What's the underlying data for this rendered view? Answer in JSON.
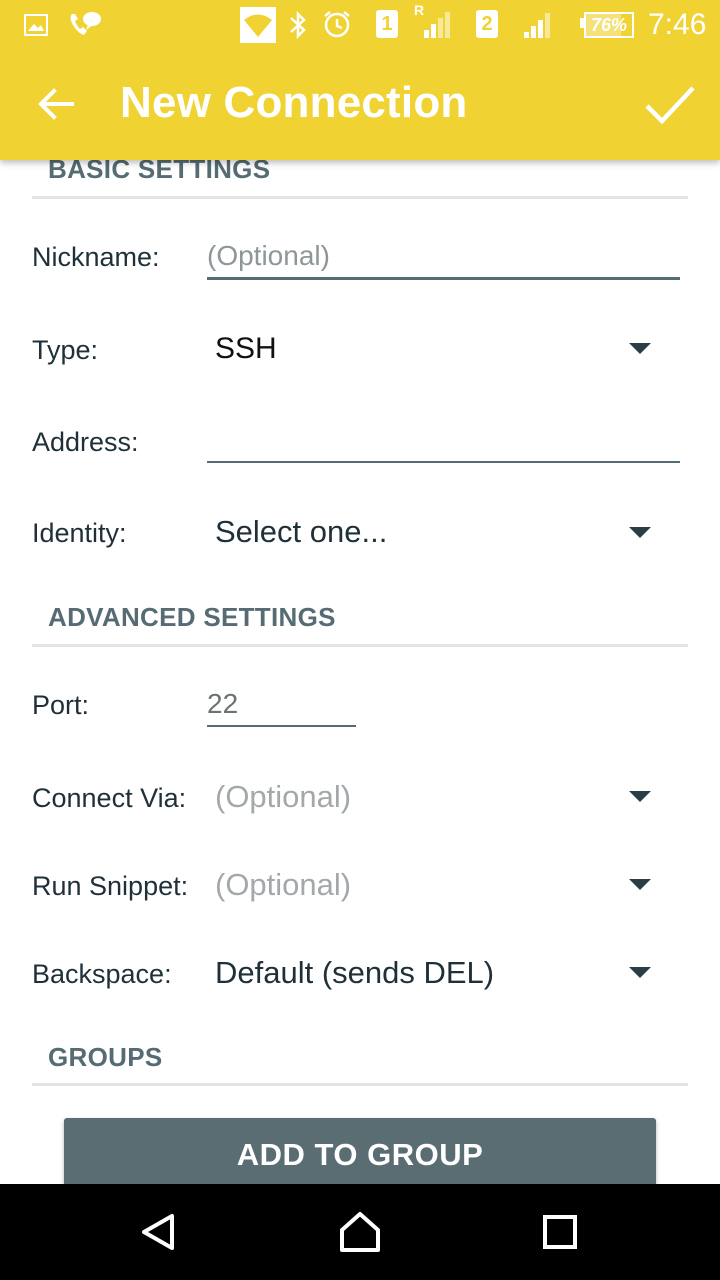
{
  "status_bar": {
    "sim1": "1",
    "sim2": "2",
    "roaming": "R",
    "battery": "76%",
    "battery_level": 0.76,
    "time": "7:46",
    "icons": [
      "image-icon",
      "chat-icon",
      "wifi-icon",
      "bluetooth-icon",
      "alarm-icon",
      "signal-icon",
      "battery-icon"
    ]
  },
  "app_bar": {
    "title": "New Connection",
    "background_color": "#f0d233",
    "back_icon": "arrow-back-icon",
    "confirm_icon": "check-icon"
  },
  "basic_settings": {
    "header": "BASIC SETTINGS",
    "nickname": {
      "label": "Nickname:",
      "value": "",
      "placeholder": "(Optional)"
    },
    "type": {
      "label": "Type:",
      "value": "SSH"
    },
    "address": {
      "label": "Address:",
      "value": ""
    },
    "identity": {
      "label": "Identity:",
      "value": "Select one..."
    }
  },
  "advanced_settings": {
    "header": "ADVANCED SETTINGS",
    "port": {
      "label": "Port:",
      "value": "22"
    },
    "connect_via": {
      "label": "Connect Via:",
      "value": "(Optional)"
    },
    "run_snippet": {
      "label": "Run Snippet:",
      "value": "(Optional)"
    },
    "backspace": {
      "label": "Backspace:",
      "value": "Default (sends DEL)"
    }
  },
  "groups": {
    "header": "GROUPS",
    "add_button": "ADD TO GROUP"
  },
  "nav_bar": {
    "icons": [
      "nav-back-icon",
      "nav-home-icon",
      "nav-recents-icon"
    ]
  }
}
